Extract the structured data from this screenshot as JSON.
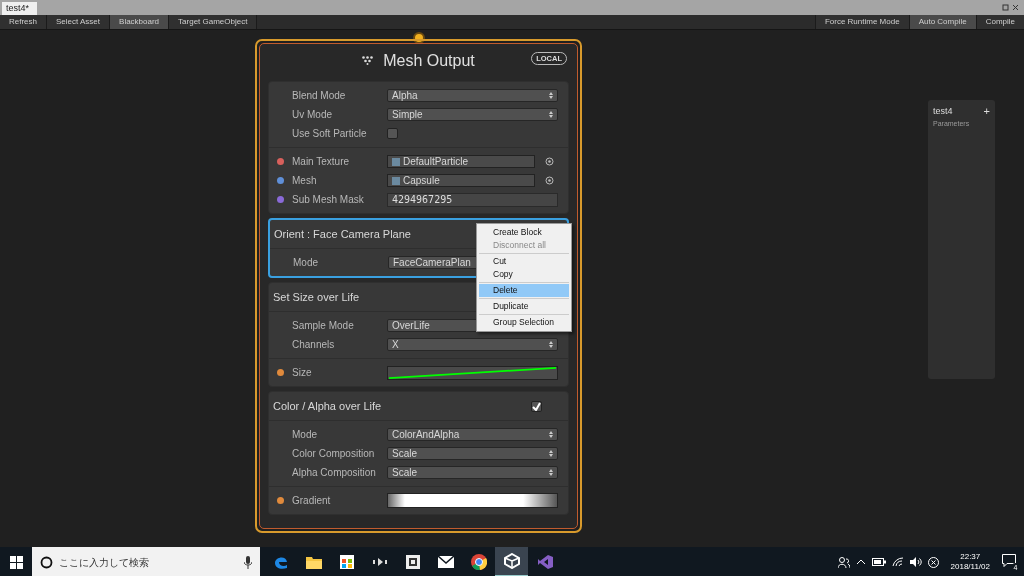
{
  "tab": {
    "label": "test4*",
    "selected": true
  },
  "toolbar": {
    "left": [
      {
        "label": "Refresh",
        "selected": false
      },
      {
        "label": "Select Asset",
        "selected": false
      },
      {
        "label": "Blackboard",
        "selected": true
      },
      {
        "label": "Target GameObject",
        "selected": false
      }
    ],
    "right": [
      {
        "label": "Force Runtime Mode",
        "selected": false
      },
      {
        "label": "Auto Compile",
        "selected": true
      },
      {
        "label": "Compile",
        "selected": false
      }
    ]
  },
  "node": {
    "title": "Mesh Output",
    "badge": "LOCAL",
    "settings": [
      {
        "kind": "dropdown",
        "label": "Blend Mode",
        "value": "Alpha"
      },
      {
        "kind": "dropdown",
        "label": "Uv Mode",
        "value": "Simple"
      },
      {
        "kind": "checkbox",
        "label": "Use Soft Particle",
        "checked": false
      }
    ],
    "slots": [
      {
        "kind": "object",
        "label": "Main Texture",
        "value": "DefaultParticle",
        "color": "#d8605c"
      },
      {
        "kind": "object",
        "label": "Mesh",
        "value": "Capsule",
        "color": "#5f8fd8"
      },
      {
        "kind": "text",
        "label": "Sub Mesh Mask",
        "value": "4294967295",
        "color": "#8a6ad8"
      }
    ],
    "blocks": [
      {
        "title": "Orient : Face Camera Plane",
        "selected": true,
        "settings": [
          {
            "kind": "dropdown",
            "label": "Mode",
            "value": "FaceCameraPlan"
          }
        ]
      },
      {
        "title": "Set Size over Life",
        "selected": false,
        "settings": [
          {
            "kind": "dropdown",
            "label": "Sample Mode",
            "value": "OverLife"
          },
          {
            "kind": "dropdown",
            "label": "Channels",
            "value": "X"
          }
        ],
        "slots": [
          {
            "kind": "curve",
            "label": "Size",
            "color": "#e08a3c"
          }
        ]
      },
      {
        "title": "Color / Alpha over Life",
        "selected": false,
        "enabled": true,
        "settings": [
          {
            "kind": "dropdown",
            "label": "Mode",
            "value": "ColorAndAlpha"
          },
          {
            "kind": "dropdown",
            "label": "Color Composition",
            "value": "Scale"
          },
          {
            "kind": "dropdown",
            "label": "Alpha Composition",
            "value": "Scale"
          }
        ],
        "slots": [
          {
            "kind": "gradient",
            "label": "Gradient",
            "color": "#e08a3c"
          }
        ]
      }
    ]
  },
  "context_menu": [
    [
      {
        "label": "Create Block",
        "disabled": false,
        "selected": false
      },
      {
        "label": "Disconnect all",
        "disabled": true,
        "selected": false
      }
    ],
    [
      {
        "label": "Cut",
        "disabled": false,
        "selected": false
      },
      {
        "label": "Copy",
        "disabled": false,
        "selected": false
      }
    ],
    [
      {
        "label": "Delete",
        "disabled": false,
        "selected": true
      }
    ],
    [
      {
        "label": "Duplicate",
        "disabled": false,
        "selected": false
      }
    ],
    [
      {
        "label": "Group Selection",
        "disabled": false,
        "selected": false
      }
    ]
  ],
  "blackboard": {
    "title": "test4",
    "subtitle": "Parameters",
    "add": "+"
  },
  "taskbar": {
    "search_placeholder": "ここに入力して検索",
    "apps": [
      {
        "kind": "edge",
        "active": false
      },
      {
        "kind": "folder",
        "active": false
      },
      {
        "kind": "store",
        "active": false
      },
      {
        "kind": "media",
        "active": false
      },
      {
        "kind": "window",
        "active": false
      },
      {
        "kind": "mail",
        "active": false
      },
      {
        "kind": "chrome",
        "active": false
      },
      {
        "kind": "unity",
        "active": true
      },
      {
        "kind": "studio",
        "active": false
      }
    ],
    "time": "22:37",
    "date": "2018/11/02",
    "notifications": "4"
  }
}
